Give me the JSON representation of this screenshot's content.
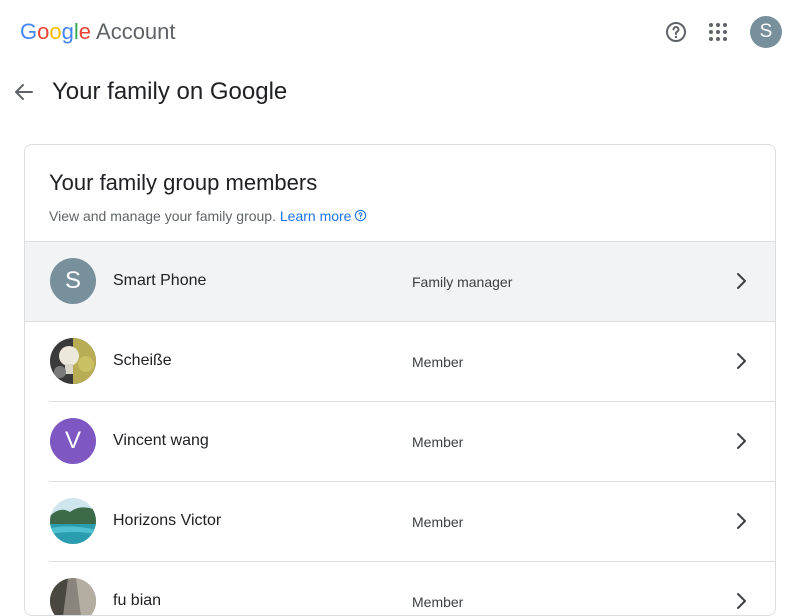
{
  "header": {
    "logo_letters": [
      "G",
      "o",
      "o",
      "g",
      "l",
      "e"
    ],
    "logo_suffix": "Account",
    "help_icon": "help-circle-icon",
    "apps_icon": "apps-grid-icon",
    "account_initial": "S"
  },
  "page": {
    "title": "Your family on Google",
    "back_icon": "arrow-back-icon"
  },
  "card": {
    "title": "Your family group members",
    "description": "View and manage your family group.",
    "learn_more": "Learn more",
    "members": [
      {
        "name": "Smart Phone",
        "role": "Family manager",
        "initial": "S",
        "avatar_color": "#78909c"
      },
      {
        "name": "Scheiße",
        "role": "Member",
        "initial": "",
        "avatar_type": "photo-bulb"
      },
      {
        "name": "Vincent wang",
        "role": "Member",
        "initial": "V",
        "avatar_color": "#7e57c2"
      },
      {
        "name": "Horizons Victor",
        "role": "Member",
        "initial": "",
        "avatar_type": "photo-lake"
      },
      {
        "name": "fu bian",
        "role": "Member",
        "initial": "",
        "avatar_type": "photo-rock"
      }
    ]
  },
  "colors": {
    "accent": "#1a73e8",
    "selected_row": "#f1f3f4",
    "divider": "#dadce0"
  }
}
